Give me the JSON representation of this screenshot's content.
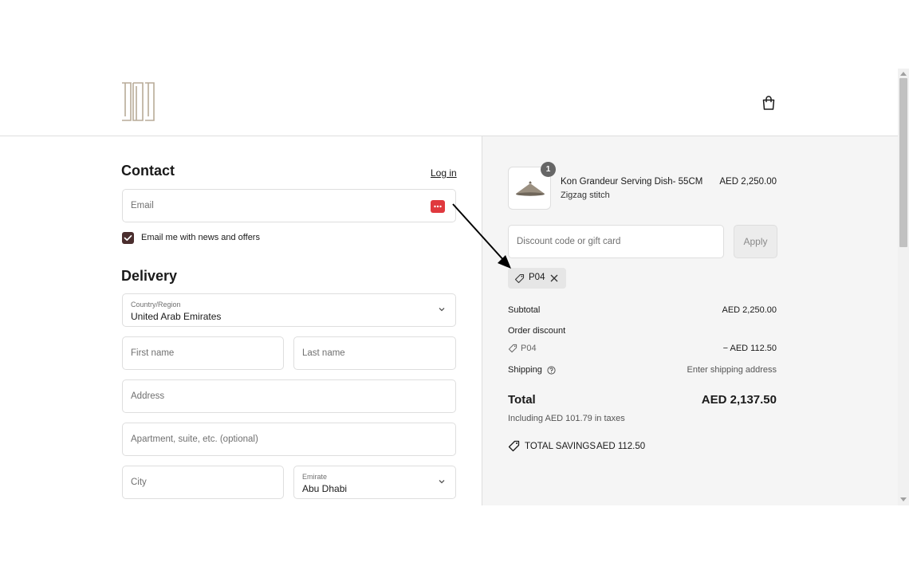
{
  "header": {
    "logo_icon": "brand-logo",
    "cart_icon": "shopping-bag-icon"
  },
  "contact": {
    "title": "Contact",
    "login_link": "Log in",
    "email_placeholder": "Email",
    "email_icon": "password-manager-icon",
    "newsletter_label": "Email me with news and offers",
    "newsletter_checked": true
  },
  "delivery": {
    "title": "Delivery",
    "country_label": "Country/Region",
    "country_value": "United Arab Emirates",
    "first_name_placeholder": "First name",
    "last_name_placeholder": "Last name",
    "address_placeholder": "Address",
    "apartment_placeholder": "Apartment, suite, etc. (optional)",
    "city_placeholder": "City",
    "emirate_label": "Emirate",
    "emirate_value": "Abu Dhabi"
  },
  "order": {
    "product_name": "Kon Grandeur Serving Dish- 55CM",
    "product_variant": "Zigzag stitch",
    "product_price": "AED 2,250.00",
    "quantity": "1",
    "discount_placeholder": "Discount code or gift card",
    "apply_label": "Apply",
    "applied_code": "P04",
    "subtotal_label": "Subtotal",
    "subtotal_value": "AED 2,250.00",
    "order_discount_label": "Order discount",
    "discount_code": "P04",
    "discount_value": "− AED 112.50",
    "shipping_label": "Shipping",
    "shipping_value": "Enter shipping address",
    "total_label": "Total",
    "total_value": "AED 2,137.50",
    "taxes_note": "Including AED 101.79 in taxes",
    "savings_label": "TOTAL SAVINGS",
    "savings_value": "AED 112.50"
  },
  "colors": {
    "accent": "#4a2e2e",
    "summary_bg": "#f5f5f5",
    "password_icon": "#e0393e"
  }
}
